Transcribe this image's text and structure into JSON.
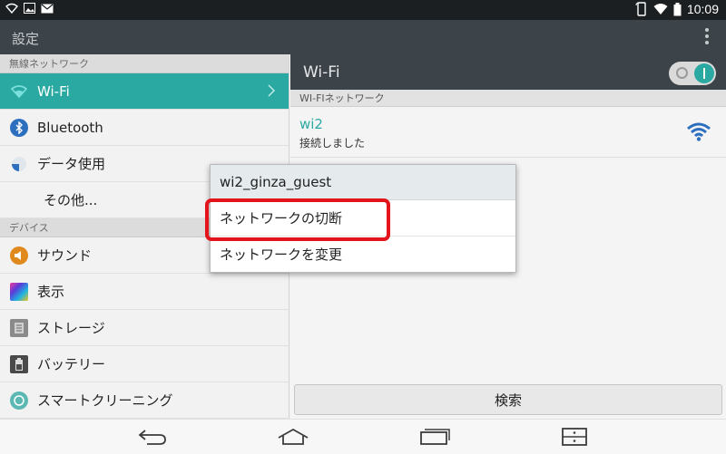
{
  "statusbar": {
    "time": "10:09"
  },
  "actionbar": {
    "title": "設定"
  },
  "left": {
    "sections": [
      {
        "label": "無線ネットワーク"
      },
      {
        "label": "デバイス"
      }
    ],
    "items": [
      {
        "label": "Wi-Fi",
        "icon": "wifi-icon"
      },
      {
        "label": "Bluetooth",
        "icon": "bluetooth-icon"
      },
      {
        "label": "データ使用",
        "icon": "data-usage-icon"
      },
      {
        "label": "その他..."
      },
      {
        "label": "サウンド",
        "icon": "sound-icon"
      },
      {
        "label": "表示",
        "icon": "display-icon"
      },
      {
        "label": "ストレージ",
        "icon": "storage-icon"
      },
      {
        "label": "バッテリー",
        "icon": "battery-icon"
      },
      {
        "label": "スマートクリーニング",
        "icon": "smart-cleaning-icon"
      }
    ]
  },
  "right": {
    "title": "Wi-Fi",
    "section": "WI-FIネットワーク",
    "network": {
      "ssid": "wi2",
      "status": "接続しました"
    },
    "scan_label": "検索"
  },
  "dialog": {
    "title": "wi2_ginza_guest",
    "options": [
      "ネットワークの切断",
      "ネットワークを変更"
    ]
  },
  "colors": {
    "accent": "#2aa9a3",
    "highlight": "#e4141d",
    "actionbar": "#3c4349"
  }
}
